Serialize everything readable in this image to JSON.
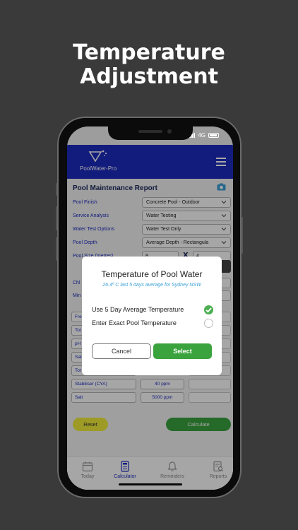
{
  "promo": {
    "line1": "Temperature",
    "line2": "Adjustment"
  },
  "status_bar": {
    "network": "4G"
  },
  "header": {
    "app_name": "PoolWater-Pro"
  },
  "report": {
    "title": "Pool Maintenance Report",
    "fields": [
      {
        "label": "Pool Finish",
        "value": "Concrete Pool - Outdoor"
      },
      {
        "label": "Service Analysis",
        "value": "Water Testing"
      },
      {
        "label": "Water Test Options",
        "value": "Water Test Only"
      },
      {
        "label": "Pool Depth",
        "value": "Average Depth - Rectangula"
      }
    ],
    "pool_size": {
      "label": "Pool Size (metres)",
      "length": "8",
      "x": "X",
      "width": "4"
    },
    "partial_labels": [
      "Chl",
      "Min"
    ],
    "params": [
      {
        "label": "Fre",
        "value": ""
      },
      {
        "label": "Tot",
        "value": ""
      },
      {
        "label": "pH",
        "value": ""
      },
      {
        "label": "Sat",
        "value": ""
      },
      {
        "label": "Tot",
        "value": ""
      },
      {
        "label": "Stabiliser (CYA)",
        "value": "40 ppm"
      },
      {
        "label": "Salt",
        "value": "5000 ppm"
      }
    ],
    "reset_label": "Reset",
    "calculate_label": "Calculate"
  },
  "modal": {
    "title": "Temperature of Pool Water",
    "subtitle": "26.4º C  last 5 days average for Sydney NSW",
    "option1": "Use 5 Day Average Temperature",
    "option2": "Enter Exact Pool Temperature",
    "cancel_label": "Cancel",
    "select_label": "Select"
  },
  "tabs": [
    {
      "label": "Today"
    },
    {
      "label": "Calculator"
    },
    {
      "label": "Reminders"
    },
    {
      "label": "Reports"
    }
  ],
  "colors": {
    "brand": "#1c2cc0",
    "accent_green": "#3aa33e",
    "reset_yellow": "#f1ee3b",
    "subtitle_blue": "#3a9fd6"
  }
}
